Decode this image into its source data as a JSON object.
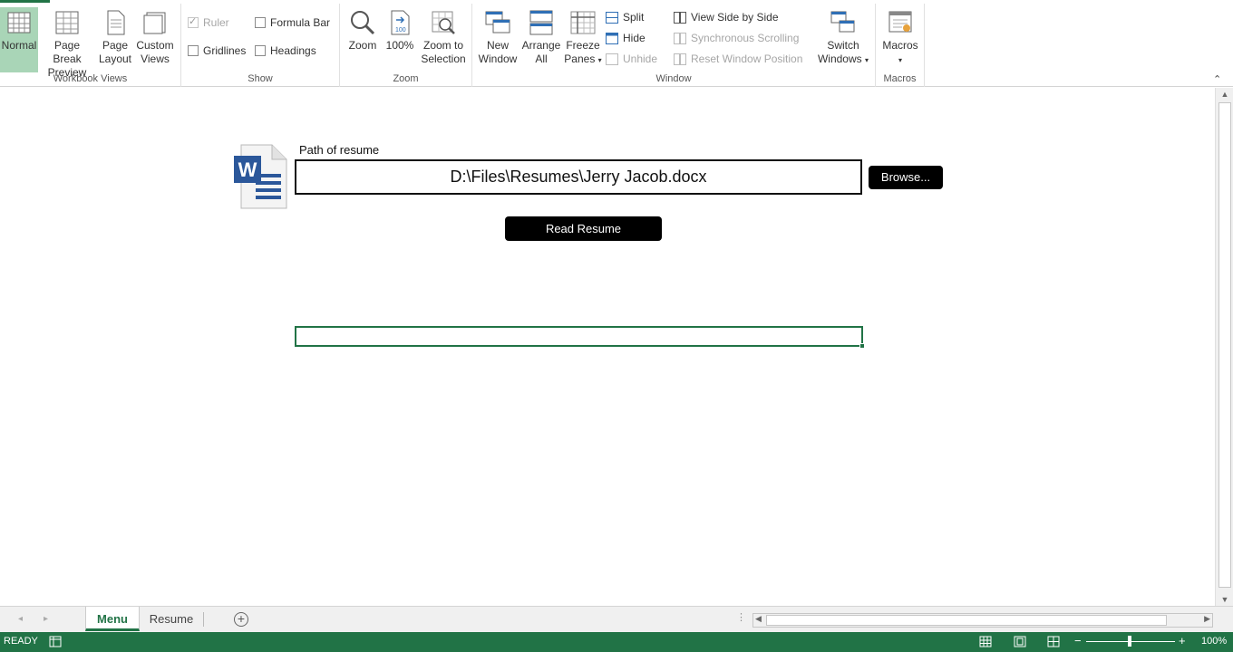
{
  "ribbon": {
    "groups": {
      "workbook_views": {
        "label": "Workbook Views",
        "normal": "Normal",
        "page_break_1": "Page Break",
        "page_break_2": "Preview",
        "page_layout_1": "Page",
        "page_layout_2": "Layout",
        "custom_views_1": "Custom",
        "custom_views_2": "Views"
      },
      "show": {
        "label": "Show",
        "ruler": "Ruler",
        "formula_bar": "Formula Bar",
        "gridlines": "Gridlines",
        "headings": "Headings",
        "ruler_checked": true,
        "formula_bar_checked": false,
        "gridlines_checked": false,
        "headings_checked": false
      },
      "zoom": {
        "label": "Zoom",
        "zoom": "Zoom",
        "hundred": "100%",
        "zoom_sel_1": "Zoom to",
        "zoom_sel_2": "Selection"
      },
      "window": {
        "label": "Window",
        "new_window_1": "New",
        "new_window_2": "Window",
        "arrange_1": "Arrange",
        "arrange_2": "All",
        "freeze_1": "Freeze",
        "freeze_2": "Panes",
        "split": "Split",
        "hide": "Hide",
        "unhide": "Unhide",
        "side_by_side": "View Side by Side",
        "sync_scroll": "Synchronous Scrolling",
        "reset_pos": "Reset Window Position",
        "switch_1": "Switch",
        "switch_2": "Windows"
      },
      "macros": {
        "label": "Macros",
        "macros": "Macros"
      }
    }
  },
  "form": {
    "path_label": "Path of resume",
    "path_value": "D:\\Files\\Resumes\\Jerry Jacob.docx",
    "browse_label": "Browse...",
    "read_label": "Read Resume"
  },
  "tabs": [
    {
      "label": "Menu",
      "active": true
    },
    {
      "label": "Resume",
      "active": false
    }
  ],
  "status": {
    "text": "READY",
    "zoom_percent": "100%",
    "zoom_value": 100
  },
  "colors": {
    "accent": "#217346",
    "active_view": "#a9d5b7"
  }
}
